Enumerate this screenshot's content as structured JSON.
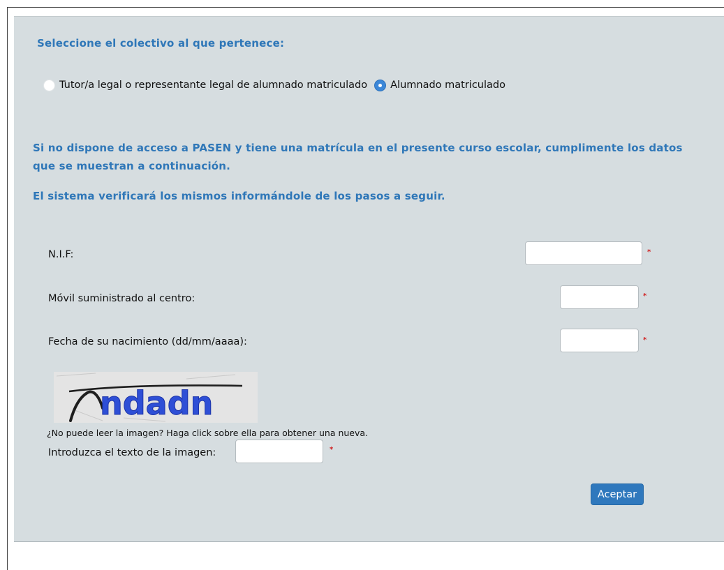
{
  "group_heading": "Seleccione el colectivo al que pertenece:",
  "radio_options": [
    {
      "label": "Tutor/a legal o representante legal de alumnado matriculado",
      "selected": false
    },
    {
      "label": "Alumnado matriculado",
      "selected": true
    }
  ],
  "info": {
    "line1": "Si no dispone de acceso a PASEN y tiene una matrícula en el presente curso escolar, cumplimente los datos que se muestran a continuación.",
    "line2": "El sistema verificará los mismos informándole de los pasos a seguir."
  },
  "fields": {
    "nif": {
      "label": "N.I.F:",
      "value": ""
    },
    "movil": {
      "label": "Móvil suministrado al centro:",
      "value": ""
    },
    "fecha": {
      "label": "Fecha de su nacimiento (dd/mm/aaaa):",
      "value": ""
    }
  },
  "required_mark": "*",
  "captcha": {
    "image_text": "ndadn",
    "note": "¿No puede leer la imagen? Haga click sobre ella para obtener una nueva.",
    "label": "Introduzca el texto de la imagen:",
    "value": ""
  },
  "submit_label": "Aceptar",
  "colors": {
    "accent": "#2f77b8",
    "panel_background": "#d6dde0",
    "required": "#d02020",
    "button": "#2f78bd"
  }
}
